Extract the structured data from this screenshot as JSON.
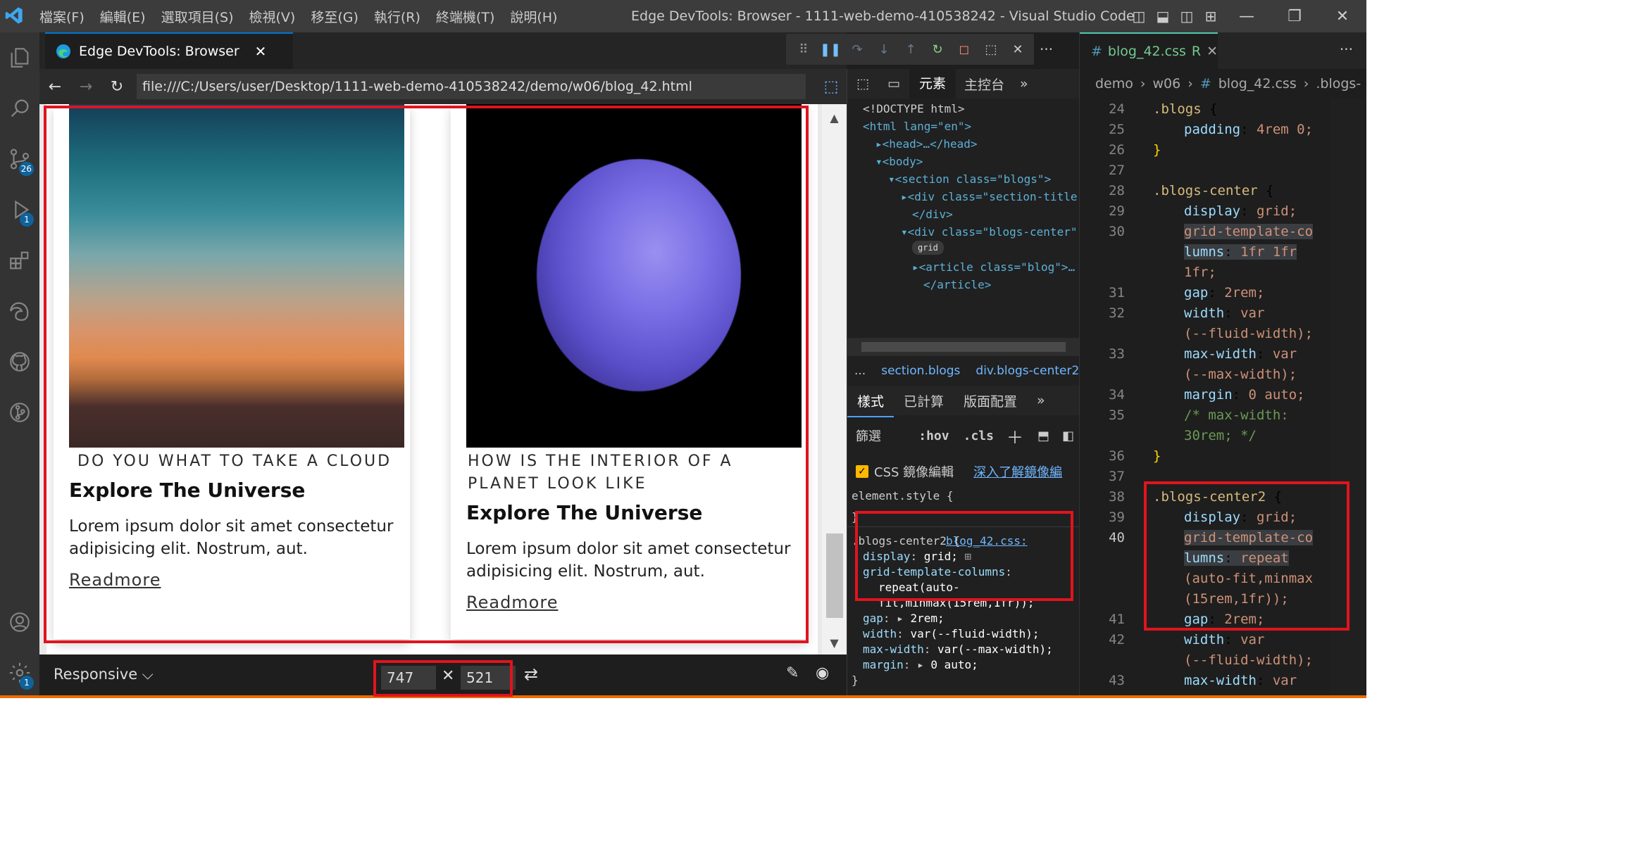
{
  "titlebar": {
    "menus": [
      "檔案(F)",
      "編輯(E)",
      "選取項目(S)",
      "檢視(V)",
      "移至(G)",
      "執行(R)",
      "終端機(T)",
      "說明(H)"
    ],
    "window_title": "Edge DevTools: Browser - 1111-web-demo-410538242 - Visual Studio Code"
  },
  "activity": {
    "badges": {
      "scm": "26",
      "debug": "1",
      "settings": "1"
    }
  },
  "browser_tab": {
    "title": "Edge DevTools: Browser"
  },
  "browser": {
    "url": "file:///C:/Users/user/Desktop/1111-web-demo-410538242/demo/w06/blog_42.html",
    "cards": [
      {
        "kicker": "DO YOU WHAT TO TAKE A CLOUD",
        "title": "Explore The Universe",
        "text": "Lorem ipsum dolor sit amet consectetur adipisicing elit. Nostrum, aut.",
        "link": "Readmore"
      },
      {
        "kicker": "HOW IS THE INTERIOR OF A PLANET LOOK LIKE",
        "title": "Explore The Universe",
        "text": "Lorem ipsum dolor sit amet consectetur adipisicing elit. Nostrum, aut.",
        "link": "Readmore"
      }
    ],
    "responsive": {
      "label": "Responsive",
      "width": "747",
      "height": "521"
    }
  },
  "devtools": {
    "top_tabs": {
      "elements": "元素",
      "console": "主控台"
    },
    "dom": [
      "<!DOCTYPE html>",
      "<html lang=\"en\">",
      "<head>…</head>",
      "<body>",
      "<section class=\"blogs\">",
      "<div class=\"section-title",
      "</div>",
      "<div class=\"blogs-center\"",
      "grid",
      "<article class=\"blog\">…",
      "</article>"
    ],
    "crumbs": [
      "...",
      "section.blogs",
      "div.blogs-center2"
    ],
    "style_tabs": [
      "樣式",
      "已計算",
      "版面配置"
    ],
    "filter": {
      "label": "篩選",
      "hov": ":hov",
      "cls": ".cls"
    },
    "mirror": {
      "label": "CSS 鏡像編輯",
      "link": "深入了解鏡像編"
    },
    "styles": {
      "element_style": "element.style {",
      "close": "}",
      "selector": ".blogs-center2 {",
      "source": "blog_42.css:",
      "source2": "blog_42.css",
      "star": "* {",
      "decls": [
        {
          "p": "display",
          "v": "grid;"
        },
        {
          "p": "grid-template-columns",
          "v": ""
        },
        {
          "p": "",
          "v": "repeat(auto-"
        },
        {
          "p": "",
          "v": "fit,minmax(15rem,1fr));"
        },
        {
          "p": "gap",
          "v": "2rem;"
        },
        {
          "p": "width",
          "v": "var(--fluid-width);"
        },
        {
          "p": "max-width",
          "v": "var(--max-width);"
        },
        {
          "p": "margin",
          "v": "0 auto;"
        }
      ]
    }
  },
  "editor": {
    "tab": "blog_42.css",
    "tab_status": "R",
    "crumbs": [
      "demo",
      "w06",
      "blog_42.css",
      ".blogs-"
    ],
    "lines": [
      {
        "n": "24",
        "t": ".blogs {"
      },
      {
        "n": "25",
        "t": "padding: 4rem 0;"
      },
      {
        "n": "26",
        "t": "}"
      },
      {
        "n": "27",
        "t": ""
      },
      {
        "n": "28",
        "t": ".blogs-center {"
      },
      {
        "n": "29",
        "t": "display: grid;"
      },
      {
        "n": "30",
        "t": "grid-template-co"
      },
      {
        "n": "",
        "t": "lumns: 1fr 1fr"
      },
      {
        "n": "",
        "t": "1fr;"
      },
      {
        "n": "31",
        "t": "gap: 2rem;"
      },
      {
        "n": "32",
        "t": "width: var"
      },
      {
        "n": "",
        "t": "(--fluid-width);"
      },
      {
        "n": "33",
        "t": "max-width: var"
      },
      {
        "n": "",
        "t": "(--max-width);"
      },
      {
        "n": "34",
        "t": "margin: 0 auto;"
      },
      {
        "n": "35",
        "t": "/* max-width:"
      },
      {
        "n": "",
        "t": "30rem; */"
      },
      {
        "n": "36",
        "t": "}"
      },
      {
        "n": "37",
        "t": ""
      },
      {
        "n": "38",
        "t": ".blogs-center2 {"
      },
      {
        "n": "39",
        "t": "display: grid;"
      },
      {
        "n": "40",
        "t": "grid-template-co"
      },
      {
        "n": "",
        "t": "lumns: repeat"
      },
      {
        "n": "",
        "t": "(auto-fit,minmax"
      },
      {
        "n": "",
        "t": "(15rem,1fr));"
      },
      {
        "n": "41",
        "t": "gap: 2rem;"
      },
      {
        "n": "42",
        "t": "width: var"
      },
      {
        "n": "",
        "t": "(--fluid-width);"
      },
      {
        "n": "43",
        "t": "max-width: var"
      },
      {
        "n": "",
        "t": "(--max-width);"
      }
    ]
  },
  "colors": {
    "accent": "#0078d4",
    "highlight_box": "#e0141e",
    "statusbar": "#ec6c00"
  }
}
